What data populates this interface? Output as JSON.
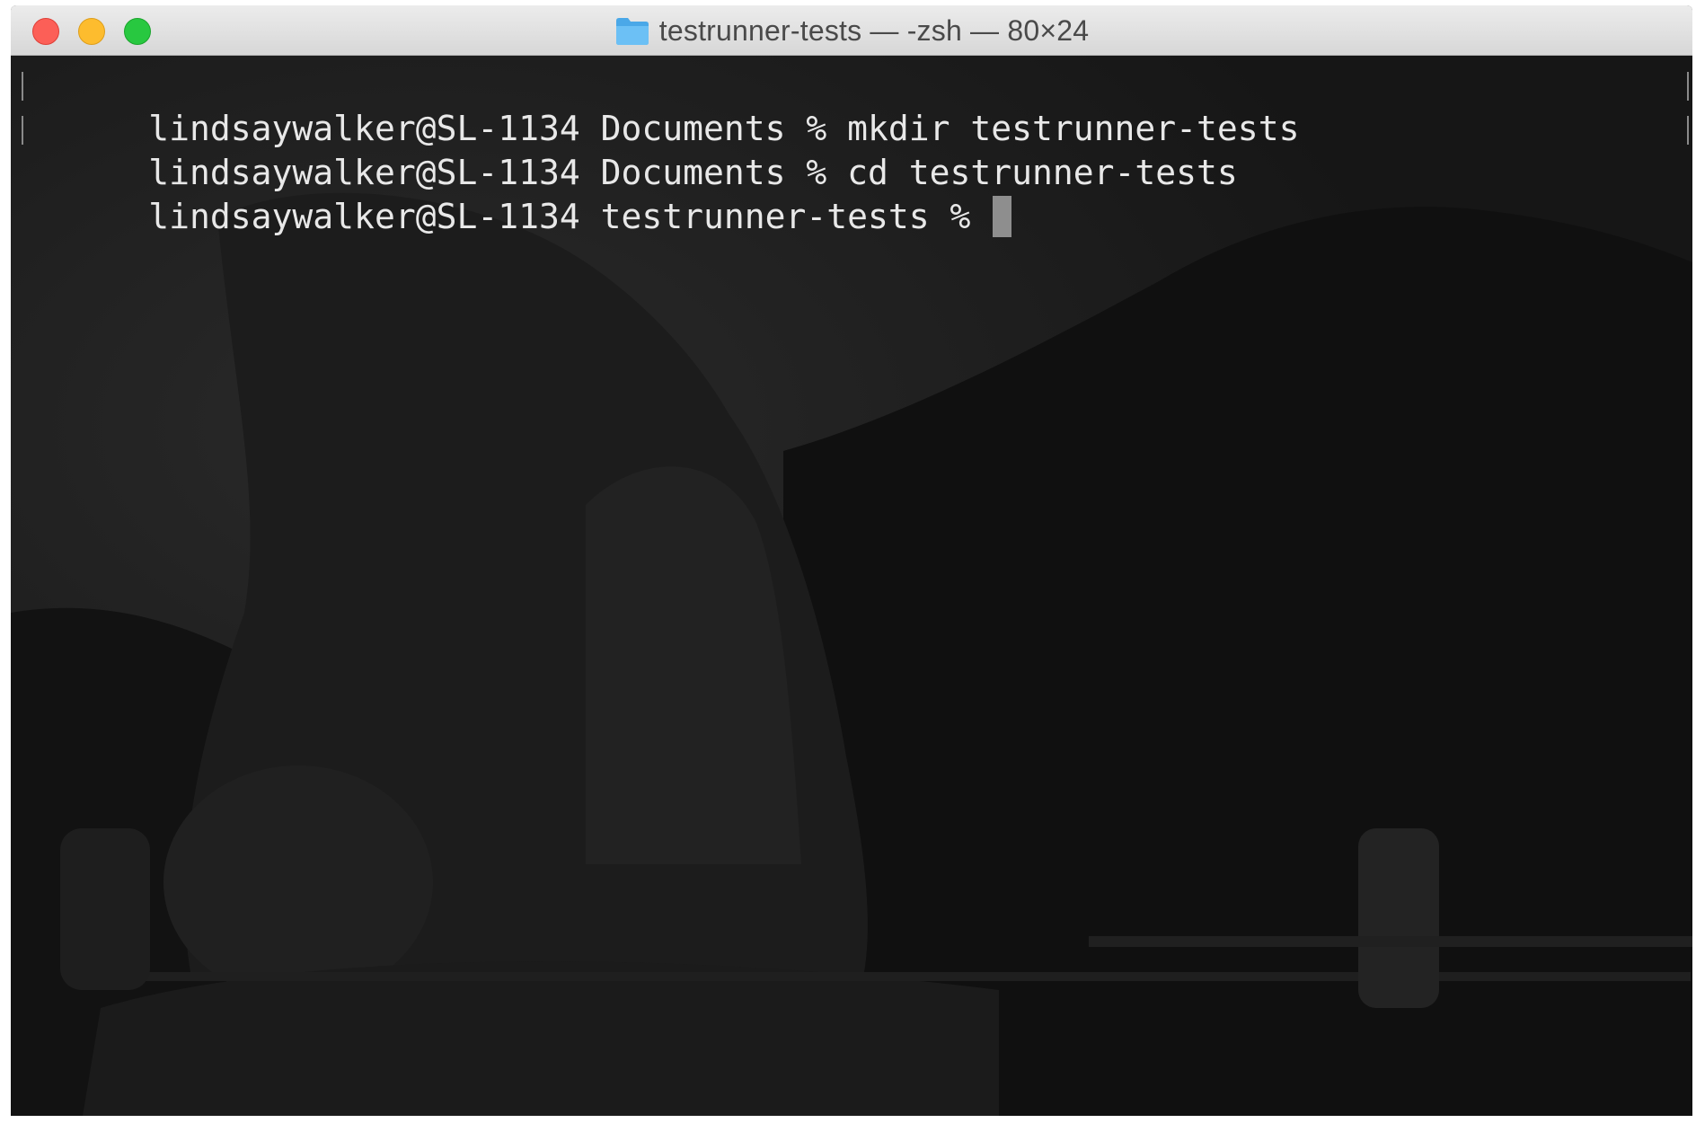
{
  "window": {
    "title": "testrunner-tests — -zsh — 80×24",
    "folder_icon": "folder-icon"
  },
  "colors": {
    "terminal_background": "#151515",
    "terminal_text": "#e8e8e8",
    "close": "#fc5f57",
    "minimize": "#fdbc2e",
    "zoom": "#28c840",
    "folder": "#5ab4ef"
  },
  "terminal": {
    "lines": [
      "lindsaywalker@SL-1134 Documents % mkdir testrunner-tests",
      "lindsaywalker@SL-1134 Documents % cd testrunner-tests",
      "lindsaywalker@SL-1134 testrunner-tests % "
    ],
    "background_image": "dimmed photo of a seated Buddha statue before a mountain"
  }
}
